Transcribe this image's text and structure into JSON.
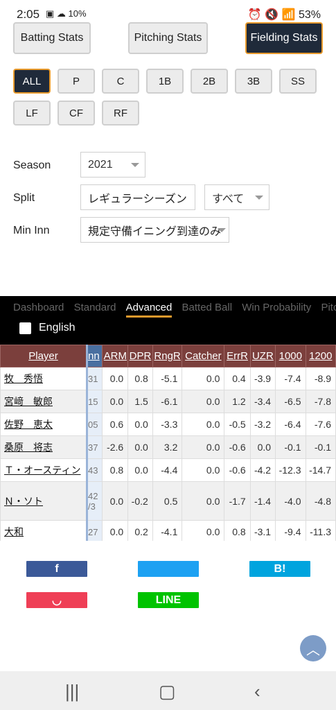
{
  "status_bar": {
    "time": "2:05",
    "icons_left": "▣ ☁ 10%",
    "right": "⏰ 🔇 📶 53%",
    "battery_pct": "53%"
  },
  "stat_tabs": [
    {
      "label": "Batting Stats",
      "active": false
    },
    {
      "label": "Pitching Stats",
      "active": false
    },
    {
      "label": "Fielding Stats",
      "active": true
    }
  ],
  "positions": [
    "ALL",
    "P",
    "C",
    "1B",
    "2B",
    "3B",
    "SS",
    "LF",
    "CF",
    "RF"
  ],
  "filters": {
    "season_label": "Season",
    "season_value": "2021",
    "split_label": "Split",
    "split_value": "レギュラーシーズン",
    "split_value2": "すべて",
    "mininn_label": "Min Inn",
    "mininn_value": "規定守備イニング到達のみ"
  },
  "subtabs": [
    "Dashboard",
    "Standard",
    "Advanced",
    "Batted Ball",
    "Win Probability",
    "Pitch Type"
  ],
  "active_subtab": "Advanced",
  "english_label": "English",
  "table": {
    "headers": [
      "Player",
      "nn",
      "ARM",
      "DPR",
      "RngR",
      "Catcher",
      "ErrR",
      "UZR",
      "1000",
      "1200"
    ],
    "rows": [
      [
        "牧　秀悟",
        "31",
        "0.0",
        "0.8",
        "-5.1",
        "0.0",
        "0.4",
        "-3.9",
        "-7.4",
        "-8.9"
      ],
      [
        "宮﨑　敏郎",
        "15",
        "0.0",
        "1.5",
        "-6.1",
        "0.0",
        "1.2",
        "-3.4",
        "-6.5",
        "-7.8"
      ],
      [
        "佐野　恵太",
        "05",
        "0.6",
        "0.0",
        "-3.3",
        "0.0",
        "-0.5",
        "-3.2",
        "-6.4",
        "-7.6"
      ],
      [
        "桑原　将志",
        "37",
        "-2.6",
        "0.0",
        "3.2",
        "0.0",
        "-0.6",
        "0.0",
        "-0.1",
        "-0.1"
      ],
      [
        "Ｔ・オースティン",
        "43",
        "0.8",
        "0.0",
        "-4.4",
        "0.0",
        "-0.6",
        "-4.2",
        "-12.3",
        "-14.7"
      ],
      [
        "Ｎ・ソト",
        "42\n/3",
        "0.0",
        "-0.2",
        "0.5",
        "0.0",
        "-1.7",
        "-1.4",
        "-4.0",
        "-4.8"
      ],
      [
        "大和",
        "27",
        "0.0",
        "0.2",
        "-4.1",
        "0.0",
        "0.8",
        "-3.1",
        "-9.4",
        "-11.3"
      ]
    ]
  },
  "share": {
    "facebook": {
      "label": "f",
      "color": "#3b5998"
    },
    "twitter": {
      "label": "",
      "color": "#1da1f2"
    },
    "hatena": {
      "label": "B!",
      "color": "#00a4de"
    },
    "pocket": {
      "label": "◡",
      "color": "#ef3f56"
    },
    "line": {
      "label": "LINE",
      "color": "#00c300"
    }
  },
  "colors": {
    "accent": "#e89a2c",
    "active_bg": "#1f2a3a",
    "header_bg": "#7b3f3c"
  }
}
